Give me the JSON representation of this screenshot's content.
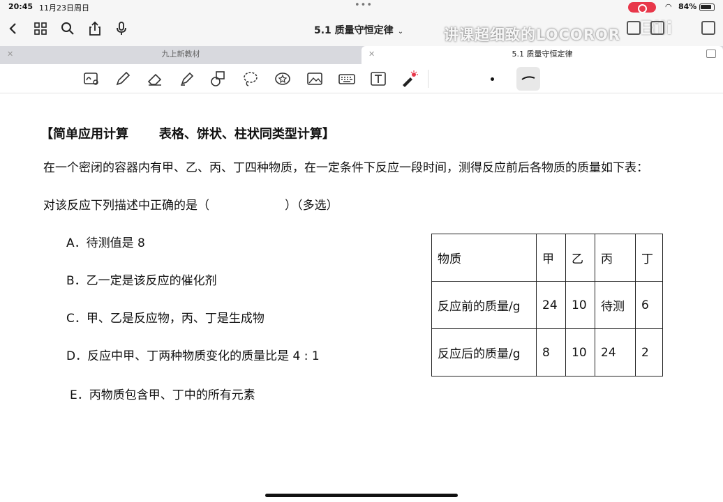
{
  "status_bar": {
    "time": "20:45",
    "date": "11月23日周日",
    "battery": "84%"
  },
  "nav": {
    "document_title": "5.1 质量守恒定律",
    "watermark_text": "讲课超细致的LOCOROR",
    "watermark_logo": "bilibili",
    "icons": [
      "back-icon",
      "grid-icon",
      "search-icon",
      "share-icon",
      "mic-icon",
      "undo-icon",
      "redo-icon",
      "more-icon"
    ]
  },
  "tabs": [
    {
      "label": "九上新教材",
      "active": false
    },
    {
      "label": "5.1 质量守恒定律",
      "active": true
    }
  ],
  "toolbar": {
    "tools": [
      "lasso-text-icon",
      "pen-icon",
      "eraser-icon",
      "highlighter-icon",
      "shapes-icon",
      "lasso-icon",
      "sticker-icon",
      "image-icon",
      "keyboard-icon",
      "textbox-icon",
      "laser-pointer-icon"
    ],
    "accent_color": "#e8374a"
  },
  "content": {
    "heading": "【简单应用计算       表格、饼状、柱状同类型计算】",
    "question_line1": "在一个密闭的容器内有甲、乙、丙、丁四种物质，在一定条件下反应一段时间，测得反应前后各物质的质量如下表：",
    "question_line2": "对该反应下列描述中正确的是（                    ）（多选）",
    "options": [
      "A．待测值是 8",
      "B．乙一定是该反应的催化剂",
      "C．甲、乙是反应物，丙、丁是生成物",
      "D．反应中甲、丁两种物质变化的质量比是 4 : 1",
      "E．丙物质包含甲、丁中的所有元素"
    ],
    "table": {
      "headers": [
        "物质",
        "甲",
        "乙",
        "丙",
        "丁"
      ],
      "rows": [
        [
          "反应前的质量/g",
          "24",
          "10",
          "待测",
          "6"
        ],
        [
          "反应后的质量/g",
          "8",
          "10",
          "24",
          "2"
        ]
      ]
    }
  }
}
